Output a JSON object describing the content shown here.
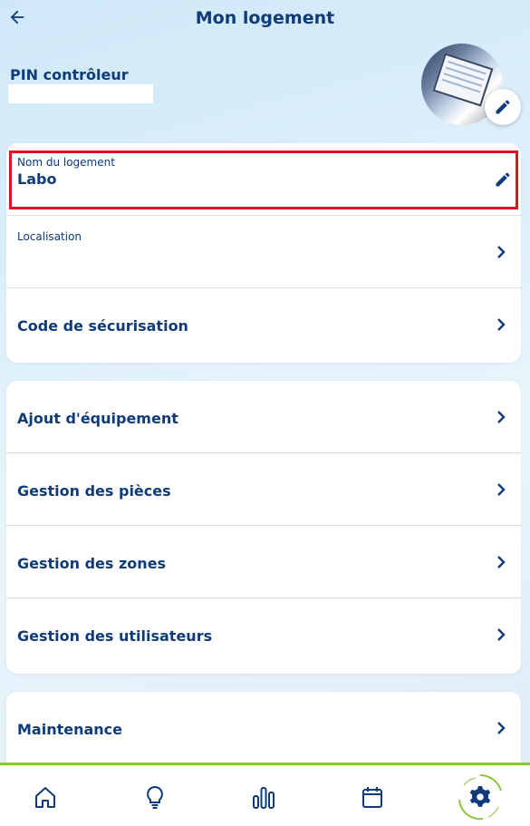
{
  "header": {
    "title": "Mon logement"
  },
  "pin": {
    "label": "PIN contrôleur",
    "value": ""
  },
  "housing_card": {
    "name_label": "Nom du logement",
    "name_value": "Labo",
    "location_label": "Localisation",
    "security_label": "Code de sécurisation"
  },
  "management_card": {
    "items": [
      {
        "label": "Ajout d'équipement"
      },
      {
        "label": "Gestion des pièces"
      },
      {
        "label": "Gestion des zones"
      },
      {
        "label": "Gestion des utilisateurs"
      }
    ]
  },
  "maintenance_card": {
    "label": "Maintenance"
  },
  "colors": {
    "primary": "#0f3b7a",
    "accent_green": "#8cc63f",
    "highlight": "#e3101e"
  },
  "bottom_nav": {
    "items": [
      {
        "icon": "home-icon"
      },
      {
        "icon": "lightbulb-icon"
      },
      {
        "icon": "bar-chart-icon"
      },
      {
        "icon": "calendar-icon"
      },
      {
        "icon": "gear-icon",
        "active": true
      }
    ]
  }
}
